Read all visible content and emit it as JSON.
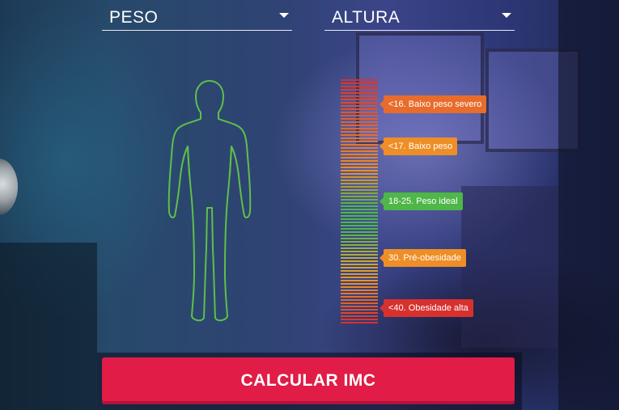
{
  "form": {
    "weight_select": {
      "value": "PESO"
    },
    "height_select": {
      "value": "ALTURA"
    },
    "submit_label": "CALCULAR  IMC"
  },
  "scale": {
    "labels": [
      {
        "text": "<16. Baixo peso severo",
        "color": "#e86c2b"
      },
      {
        "text": "<17. Baixo peso",
        "color": "#ee8e26"
      },
      {
        "text": "18-25. Peso ideal",
        "color": "#4fb648"
      },
      {
        "text": "30. Pré-obesidade",
        "color": "#ee8e26"
      },
      {
        "text": "<40. Obesidade alta",
        "color": "#d7312e"
      }
    ]
  },
  "colors": {
    "accent_button": "#e11c47",
    "figure_outline": "#5fbf4a"
  },
  "icons": {
    "dropdown": "chevron-down-icon",
    "figure": "human-body-icon"
  }
}
